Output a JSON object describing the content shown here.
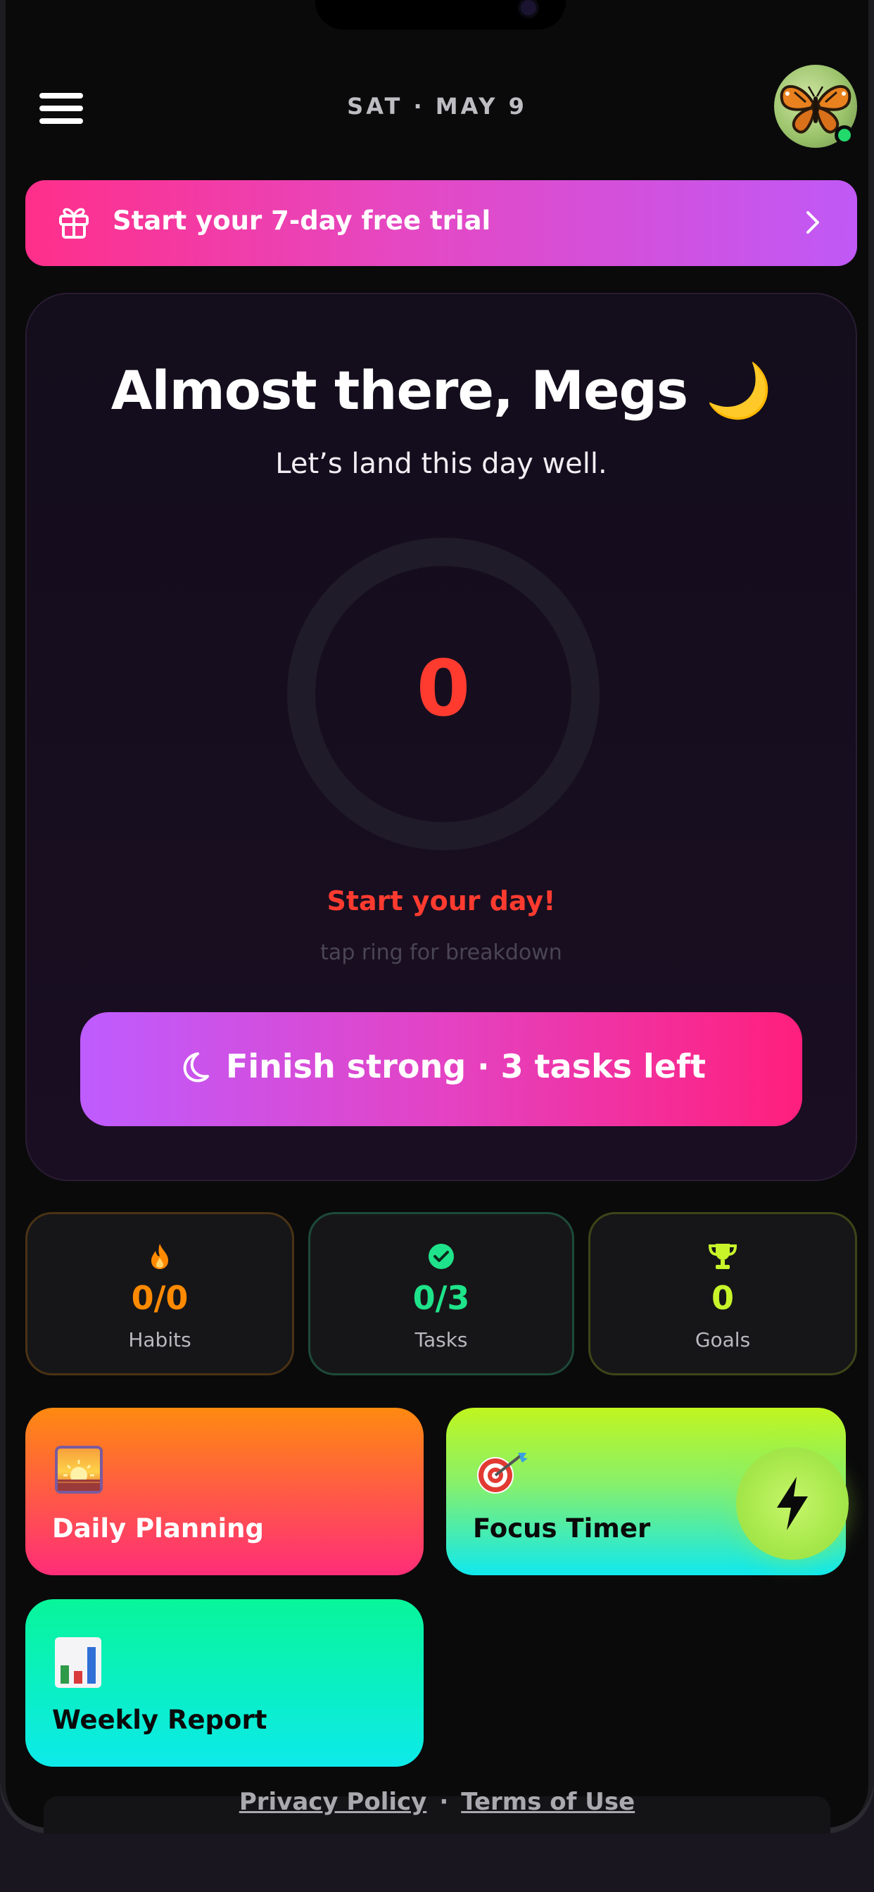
{
  "header": {
    "date": "SAT · MAY 9",
    "menu_icon": "hamburger-menu-icon",
    "avatar_icon": "butterfly-avatar"
  },
  "trial_banner": {
    "icon": "gift-icon",
    "label": "Start your 7-day free trial",
    "chevron": "chevron-right-icon"
  },
  "hero": {
    "title": "Almost there, Megs 🌙",
    "subtitle": "Let’s land this day well.",
    "score": "0",
    "status": "Start your day!",
    "hint": "tap ring for breakdown",
    "button_label": "Finish strong · 3 tasks left",
    "button_icon": "moon-icon"
  },
  "stats": [
    {
      "icon": "flame-icon",
      "value": "0/0",
      "label": "Habits",
      "color": "#ff8a00",
      "border": "#4a3214"
    },
    {
      "icon": "check-circle-icon",
      "value": "0/3",
      "label": "Tasks",
      "color": "#1fe38a",
      "border": "#1d4a38"
    },
    {
      "icon": "trophy-icon",
      "value": "0",
      "label": "Goals",
      "color": "#c7f52a",
      "border": "#3f4418"
    }
  ],
  "tiles": {
    "daily_planning": {
      "label": "Daily Planning",
      "icon": "sunrise-emoji"
    },
    "focus_timer": {
      "label": "Focus Timer",
      "icon": "dart-target-emoji"
    },
    "weekly_report": {
      "label": "Weekly Report",
      "icon": "bar-chart-emoji"
    }
  },
  "fab": {
    "icon": "lightning-bolt-icon"
  },
  "footer": {
    "privacy": "Privacy Policy",
    "separator": "·",
    "terms": "Terms of Use"
  },
  "colors": {
    "background": "#0a0a0b",
    "accent_pink": "#ff2f8a",
    "accent_purple": "#c059f6",
    "score_red": "#ff3b30"
  }
}
